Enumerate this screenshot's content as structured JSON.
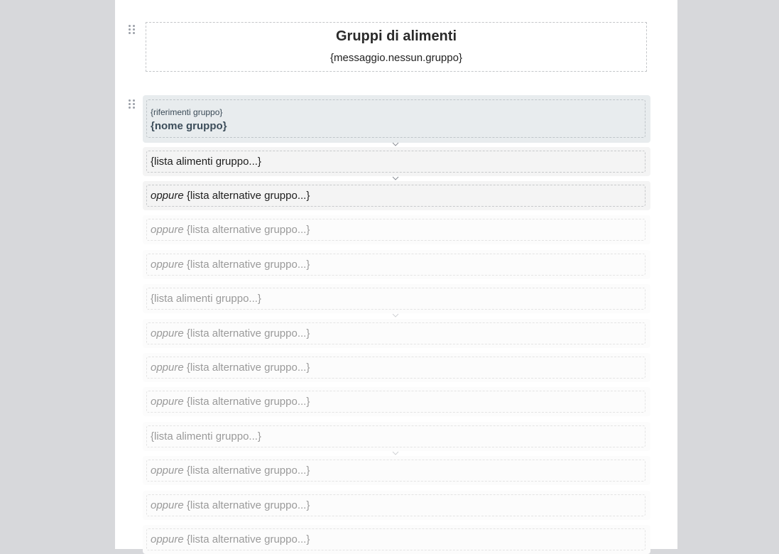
{
  "header": {
    "title": "Gruppi di alimenti",
    "message": "{messaggio.nessun.gruppo}"
  },
  "group": {
    "reference": "{riferimenti gruppo}",
    "name": "{nome gruppo}"
  },
  "rows": [
    {
      "prefix": "",
      "text": "{lista alimenti gruppo...}",
      "state": "active"
    },
    {
      "prefix": "oppure",
      "text": " {lista alternative gruppo...}",
      "state": "active"
    },
    {
      "prefix": "oppure",
      "text": " {lista alternative gruppo...}",
      "state": "faded"
    },
    {
      "prefix": "oppure",
      "text": " {lista alternative gruppo...}",
      "state": "faded"
    },
    {
      "prefix": "",
      "text": "{lista alimenti gruppo...}",
      "state": "faded"
    },
    {
      "prefix": "oppure",
      "text": " {lista alternative gruppo...}",
      "state": "faded"
    },
    {
      "prefix": "oppure",
      "text": " {lista alternative gruppo...}",
      "state": "faded"
    },
    {
      "prefix": "oppure",
      "text": " {lista alternative gruppo...}",
      "state": "faded"
    },
    {
      "prefix": "",
      "text": "{lista alimenti gruppo...}",
      "state": "faded"
    },
    {
      "prefix": "oppure",
      "text": " {lista alternative gruppo...}",
      "state": "faded"
    },
    {
      "prefix": "oppure",
      "text": " {lista alternative gruppo...}",
      "state": "faded"
    },
    {
      "prefix": "oppure",
      "text": " {lista alternative gruppo...}",
      "state": "faded"
    }
  ],
  "icons": {
    "drag": "drag-handle-icon",
    "chevron": "chevron-down-icon"
  },
  "colors": {
    "page_bg": "#d7d8db",
    "group_bg": "#e8ecee",
    "group_text": "#3c4d5a"
  }
}
